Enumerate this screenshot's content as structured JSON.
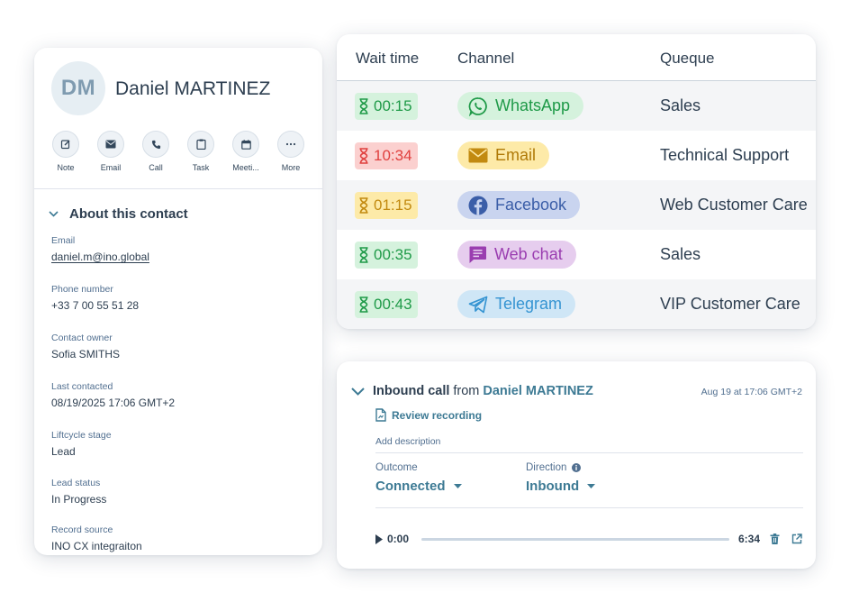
{
  "contact": {
    "initials": "DM",
    "name": "Daniel MARTINEZ",
    "actions": [
      {
        "label": "Note",
        "icon": "edit-icon"
      },
      {
        "label": "Email",
        "icon": "envelope-icon"
      },
      {
        "label": "Call",
        "icon": "phone-icon"
      },
      {
        "label": "Task",
        "icon": "clipboard-icon"
      },
      {
        "label": "Meeti...",
        "icon": "calendar-icon"
      },
      {
        "label": "More",
        "icon": "more-icon"
      }
    ],
    "about_title": "About this contact",
    "fields": {
      "email": {
        "label": "Email",
        "value": "daniel.m@ino.global"
      },
      "phone": {
        "label": "Phone number",
        "value": "+33 7 00 55 51 28"
      },
      "owner": {
        "label": "Contact owner",
        "value": "Sofia SMITHS"
      },
      "last_contacted": {
        "label": "Last contacted",
        "value": "08/19/2025 17:06 GMT+2"
      },
      "lifecycle": {
        "label": "Liftcycle stage",
        "value": "Lead"
      },
      "lead_status": {
        "label": "Lead status",
        "value": "In Progress"
      },
      "source": {
        "label": "Record source",
        "value": "INO CX integraiton"
      }
    }
  },
  "queue_table": {
    "headers": {
      "wait_time": "Wait time",
      "channel": "Channel",
      "queue": "Queque"
    },
    "rows": [
      {
        "wait": "00:15",
        "wait_status": "green",
        "channel": "WhatsApp",
        "channel_icon": "whatsapp-icon",
        "queue": "Sales"
      },
      {
        "wait": "10:34",
        "wait_status": "red",
        "channel": "Email",
        "channel_icon": "envelope-icon",
        "queue": "Technical Support"
      },
      {
        "wait": "01:15",
        "wait_status": "yellow",
        "channel": "Facebook",
        "channel_icon": "facebook-icon",
        "queue": "Web Customer Care"
      },
      {
        "wait": "00:35",
        "wait_status": "green",
        "channel": "Web chat",
        "channel_icon": "chat-icon",
        "queue": "Sales"
      },
      {
        "wait": "00:43",
        "wait_status": "green",
        "channel": "Telegram",
        "channel_icon": "telegram-icon",
        "queue": "VIP Customer Care"
      }
    ]
  },
  "call": {
    "title_bold": "Inbound call",
    "title_from": "from",
    "caller": "Daniel MARTINEZ",
    "date": "Aug 19 at 17:06 GMT+2",
    "review_label": "Review recording",
    "add_description": "Add description",
    "outcome": {
      "label": "Outcome",
      "value": "Connected"
    },
    "direction": {
      "label": "Direction",
      "value": "Inbound"
    },
    "player": {
      "current": "0:00",
      "duration": "6:34",
      "progress": 0
    }
  },
  "colors": {
    "link": "#3d7a94",
    "green_bg": "#d5f2dd",
    "green_fg": "#1f9a48",
    "red_bg": "#fbd0cf",
    "red_fg": "#e0413f",
    "yellow_bg": "#fdeaa8",
    "yellow_fg": "#c28a10"
  }
}
